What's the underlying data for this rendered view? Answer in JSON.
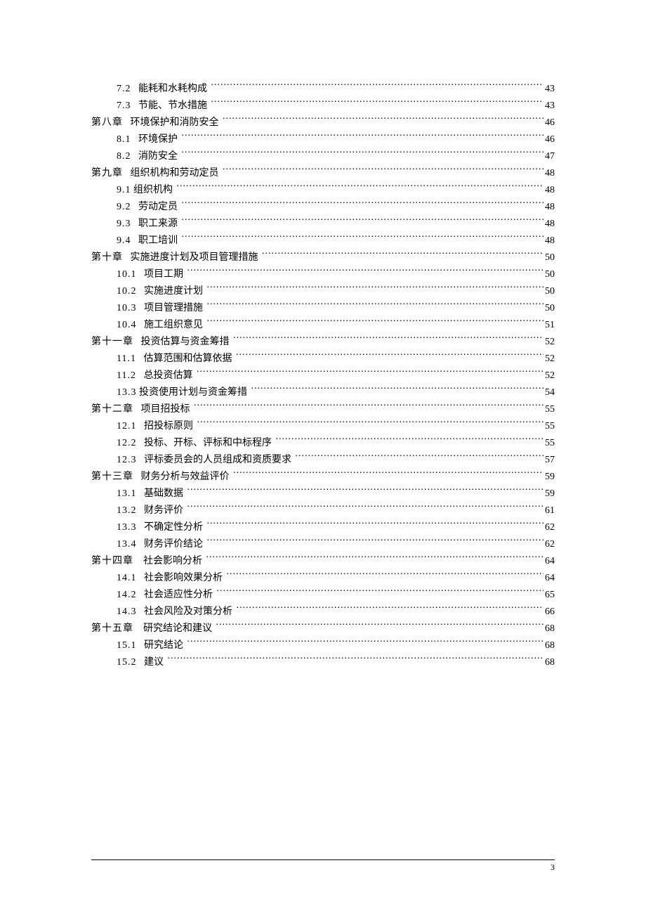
{
  "pageNumber": "3",
  "toc": [
    {
      "indent": 2,
      "num": "7.2",
      "sep": "   ",
      "title": "能耗和水耗构成",
      "page": "43"
    },
    {
      "indent": 2,
      "num": "7.3",
      "sep": "   ",
      "title": "节能、节水措施",
      "page": "43"
    },
    {
      "indent": 1,
      "num": "第八章",
      "sep": "   ",
      "title": "环境保护和消防安全",
      "page": "46"
    },
    {
      "indent": 2,
      "num": "8.1",
      "sep": "   ",
      "title": "环境保护",
      "page": "46"
    },
    {
      "indent": 2,
      "num": "8.2",
      "sep": "   ",
      "title": "消防安全",
      "page": "47"
    },
    {
      "indent": 1,
      "num": "第九章",
      "sep": "   ",
      "title": "组织机构和劳动定员",
      "page": "48"
    },
    {
      "indent": 2,
      "num": "9.1",
      "sep": " ",
      "title": "组织机构",
      "page": "48"
    },
    {
      "indent": 2,
      "num": "9.2",
      "sep": "   ",
      "title": "劳动定员",
      "page": "48"
    },
    {
      "indent": 2,
      "num": "9.3",
      "sep": "   ",
      "title": "职工来源",
      "page": "48"
    },
    {
      "indent": 2,
      "num": "9.4",
      "sep": "   ",
      "title": "职工培训",
      "page": "48"
    },
    {
      "indent": 1,
      "num": "第十章",
      "sep": "   ",
      "title": "实施进度计划及项目管理措施",
      "page": "50"
    },
    {
      "indent": 2,
      "num": "10.1",
      "sep": "   ",
      "title": "项目工期",
      "page": "50"
    },
    {
      "indent": 2,
      "num": "10.2",
      "sep": "   ",
      "title": "实施进度计划",
      "page": "50"
    },
    {
      "indent": 2,
      "num": "10.3",
      "sep": "   ",
      "title": "项目管理措施",
      "page": "50"
    },
    {
      "indent": 2,
      "num": "10.4",
      "sep": "   ",
      "title": "施工组织意见",
      "page": "51"
    },
    {
      "indent": 1,
      "num": "第十一章",
      "sep": "   ",
      "title": "投资估算与资金筹措",
      "page": "52"
    },
    {
      "indent": 2,
      "num": "11.1",
      "sep": "   ",
      "title": "估算范围和估算依据",
      "page": "52"
    },
    {
      "indent": 2,
      "num": "11.2",
      "sep": "   ",
      "title": "总投资估算",
      "page": "52"
    },
    {
      "indent": 2,
      "num": "13.3",
      "sep": " ",
      "title": "投资使用计划与资金筹措",
      "page": "54"
    },
    {
      "indent": 1,
      "num": "第十二章",
      "sep": "   ",
      "title": "项目招投标",
      "page": "55"
    },
    {
      "indent": 2,
      "num": "12.1",
      "sep": "   ",
      "title": "招投标原则",
      "page": "55"
    },
    {
      "indent": 2,
      "num": "12.2",
      "sep": "   ",
      "title": "投标、开标、评标和中标程序",
      "page": "55"
    },
    {
      "indent": 2,
      "num": "12.3",
      "sep": "   ",
      "title": "评标委员会的人员组成和资质要求",
      "page": "57"
    },
    {
      "indent": 1,
      "num": "第十三章",
      "sep": "   ",
      "title": "财务分析与效益评价",
      "page": "59"
    },
    {
      "indent": 2,
      "num": "13.1",
      "sep": "   ",
      "title": "基础数据",
      "page": "59"
    },
    {
      "indent": 2,
      "num": "13.2",
      "sep": "   ",
      "title": "财务评价",
      "page": "61"
    },
    {
      "indent": 2,
      "num": "13.3",
      "sep": "   ",
      "title": "不确定性分析",
      "page": "62"
    },
    {
      "indent": 2,
      "num": "13.4",
      "sep": "   ",
      "title": "财务评价结论",
      "page": "62"
    },
    {
      "indent": 1,
      "num": "第十四章",
      "sep": "    ",
      "title": "社会影响分析",
      "page": "64"
    },
    {
      "indent": 2,
      "num": "14.1",
      "sep": "   ",
      "title": "社会影响效果分析",
      "page": "64"
    },
    {
      "indent": 2,
      "num": "14.2",
      "sep": "   ",
      "title": "社会适应性分析",
      "page": "65"
    },
    {
      "indent": 2,
      "num": "14.3",
      "sep": "   ",
      "title": "社会风险及对策分析",
      "page": "66"
    },
    {
      "indent": 1,
      "num": "第十五章",
      "sep": "    ",
      "title": "研究结论和建议",
      "page": "68"
    },
    {
      "indent": 2,
      "num": "15.1",
      "sep": "   ",
      "title": "研究结论",
      "page": "68"
    },
    {
      "indent": 2,
      "num": "15.2",
      "sep": "   ",
      "title": "建议",
      "page": "68"
    }
  ]
}
